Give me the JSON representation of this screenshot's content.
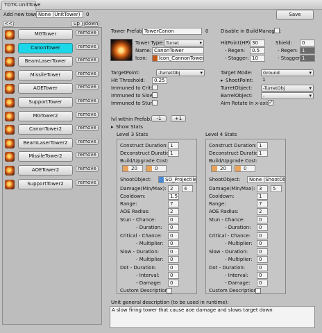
{
  "window": {
    "title": "TDTK.UnitTowe"
  },
  "add_tower": {
    "label": "Add new tower:",
    "value": "None (UnitTower)",
    "count": "0"
  },
  "nav": {
    "back": "<<",
    "up": "up",
    "down": "down"
  },
  "save_label": "Save",
  "remove_label": "remove",
  "towers": [
    {
      "name": "MGTower",
      "selected": false
    },
    {
      "name": "CanonTower",
      "selected": true
    },
    {
      "name": "BeamLaserTower",
      "selected": false
    },
    {
      "name": "MissileTower",
      "selected": false
    },
    {
      "name": "AOETower",
      "selected": false
    },
    {
      "name": "SupportTower",
      "selected": false
    },
    {
      "name": "MGTower2",
      "selected": false
    },
    {
      "name": "CanonTower2",
      "selected": false
    },
    {
      "name": "BeamLaserTower2",
      "selected": false
    },
    {
      "name": "MissileTower2",
      "selected": false
    },
    {
      "name": "AOETower2",
      "selected": false
    },
    {
      "name": "SupportTower2",
      "selected": false
    }
  ],
  "prefab": {
    "label": "Tower Prefab:",
    "value": "TowerCanon",
    "count": "0"
  },
  "disable_build": {
    "label": "Disable in BuildManager:"
  },
  "tower_type": {
    "label": "Tower Type:",
    "value": "Turret"
  },
  "name_field": {
    "label": "Name:",
    "value": "CanonTower"
  },
  "icon_field": {
    "label": "Icon:",
    "value": "Icon_CannonTower"
  },
  "hp": {
    "label": "HitPoint(HP):",
    "value": "30"
  },
  "hp_regen": {
    "label": "- Regen:",
    "value": "0.5"
  },
  "hp_stagger": {
    "label": "- Stagger:",
    "value": "10"
  },
  "shield": {
    "label": "Shield:",
    "value": "0"
  },
  "shield_regen": {
    "label": "- Regen:",
    "value": "1"
  },
  "shield_stagger": {
    "label": "- Stagger:",
    "value": "1"
  },
  "target_point": {
    "label": "TargetPoint:",
    "value": "-TurretObj"
  },
  "hit_threshold": {
    "label": "Hit Threshold:",
    "value": "0.25"
  },
  "immune_crit": {
    "label": "Immuned to Crit:"
  },
  "immune_slow": {
    "label": "Immuned to Slow:"
  },
  "immune_stun": {
    "label": "Immuned to Stun:"
  },
  "target_mode": {
    "label": "Target Mode:",
    "value": "Ground"
  },
  "shoot_point": {
    "label": "ShootPoint:",
    "value": "1"
  },
  "turret_object": {
    "label": "TurretObject:",
    "value": "-TurretObj"
  },
  "barrel_object": {
    "label": "BarrelObject:",
    "value": "-"
  },
  "aim_rotate": {
    "label": "Aim Rotate In x-axis:"
  },
  "lvl_prefab": {
    "label": "lvl within Prefab:",
    "minus": "-1",
    "plus": "+1"
  },
  "show_stats": {
    "label": "Show Stats"
  },
  "stats_labels": {
    "construct": "Construct Duration:",
    "deconstruct": "Deconstruct Duration:",
    "cost": "Build/Upgrade Cost:",
    "shoot_object": "ShootObject:",
    "damage": "Damage(Min/Max):",
    "cooldown": "Cooldown:",
    "range": "Range:",
    "aoe": "AOE Radius:",
    "stun_chance": "Stun  - Chance:",
    "stun_duration": "- Duration:",
    "crit_chance": "Critical  - Chance:",
    "crit_mult": "- Multiplier:",
    "slow_duration": "Slow  - Duration:",
    "slow_mult": "- Multiplier:",
    "dot_duration": "Dot   - Duration:",
    "dot_interval": "- Interval:",
    "dot_damage": "- Damage:",
    "custom_desc": "Custom Description:"
  },
  "levels": [
    {
      "title": "Level 3 Stats",
      "construct": "1",
      "deconstruct": "1",
      "cost1": "20",
      "cost2": "0",
      "shoot_object": "SO_Projectile_",
      "dmg_min": "2",
      "dmg_max": "4",
      "cooldown": "1.5",
      "range": "7",
      "aoe": "2",
      "stun_chance": "0",
      "stun_duration": "0",
      "crit_chance": "0",
      "crit_mult": "0",
      "slow_duration": "0",
      "slow_mult": "0",
      "dot_duration": "0",
      "dot_interval": "0",
      "dot_damage": "0"
    },
    {
      "title": "Level 4 Stats",
      "construct": "1",
      "deconstruct": "1",
      "cost1": "20",
      "cost2": "0",
      "shoot_object": "None (ShootObje",
      "dmg_min": "3",
      "dmg_max": "5",
      "cooldown": "1",
      "range": "7",
      "aoe": "2",
      "stun_chance": "0",
      "stun_duration": "0",
      "crit_chance": "0",
      "crit_mult": "0",
      "slow_duration": "0",
      "slow_mult": "0",
      "dot_duration": "0",
      "dot_interval": "0",
      "dot_damage": "0"
    }
  ],
  "description": {
    "label": "Unit general description (to be used in runtime):",
    "value": "A slow firing tower that cause aoe damage and slows target down"
  }
}
